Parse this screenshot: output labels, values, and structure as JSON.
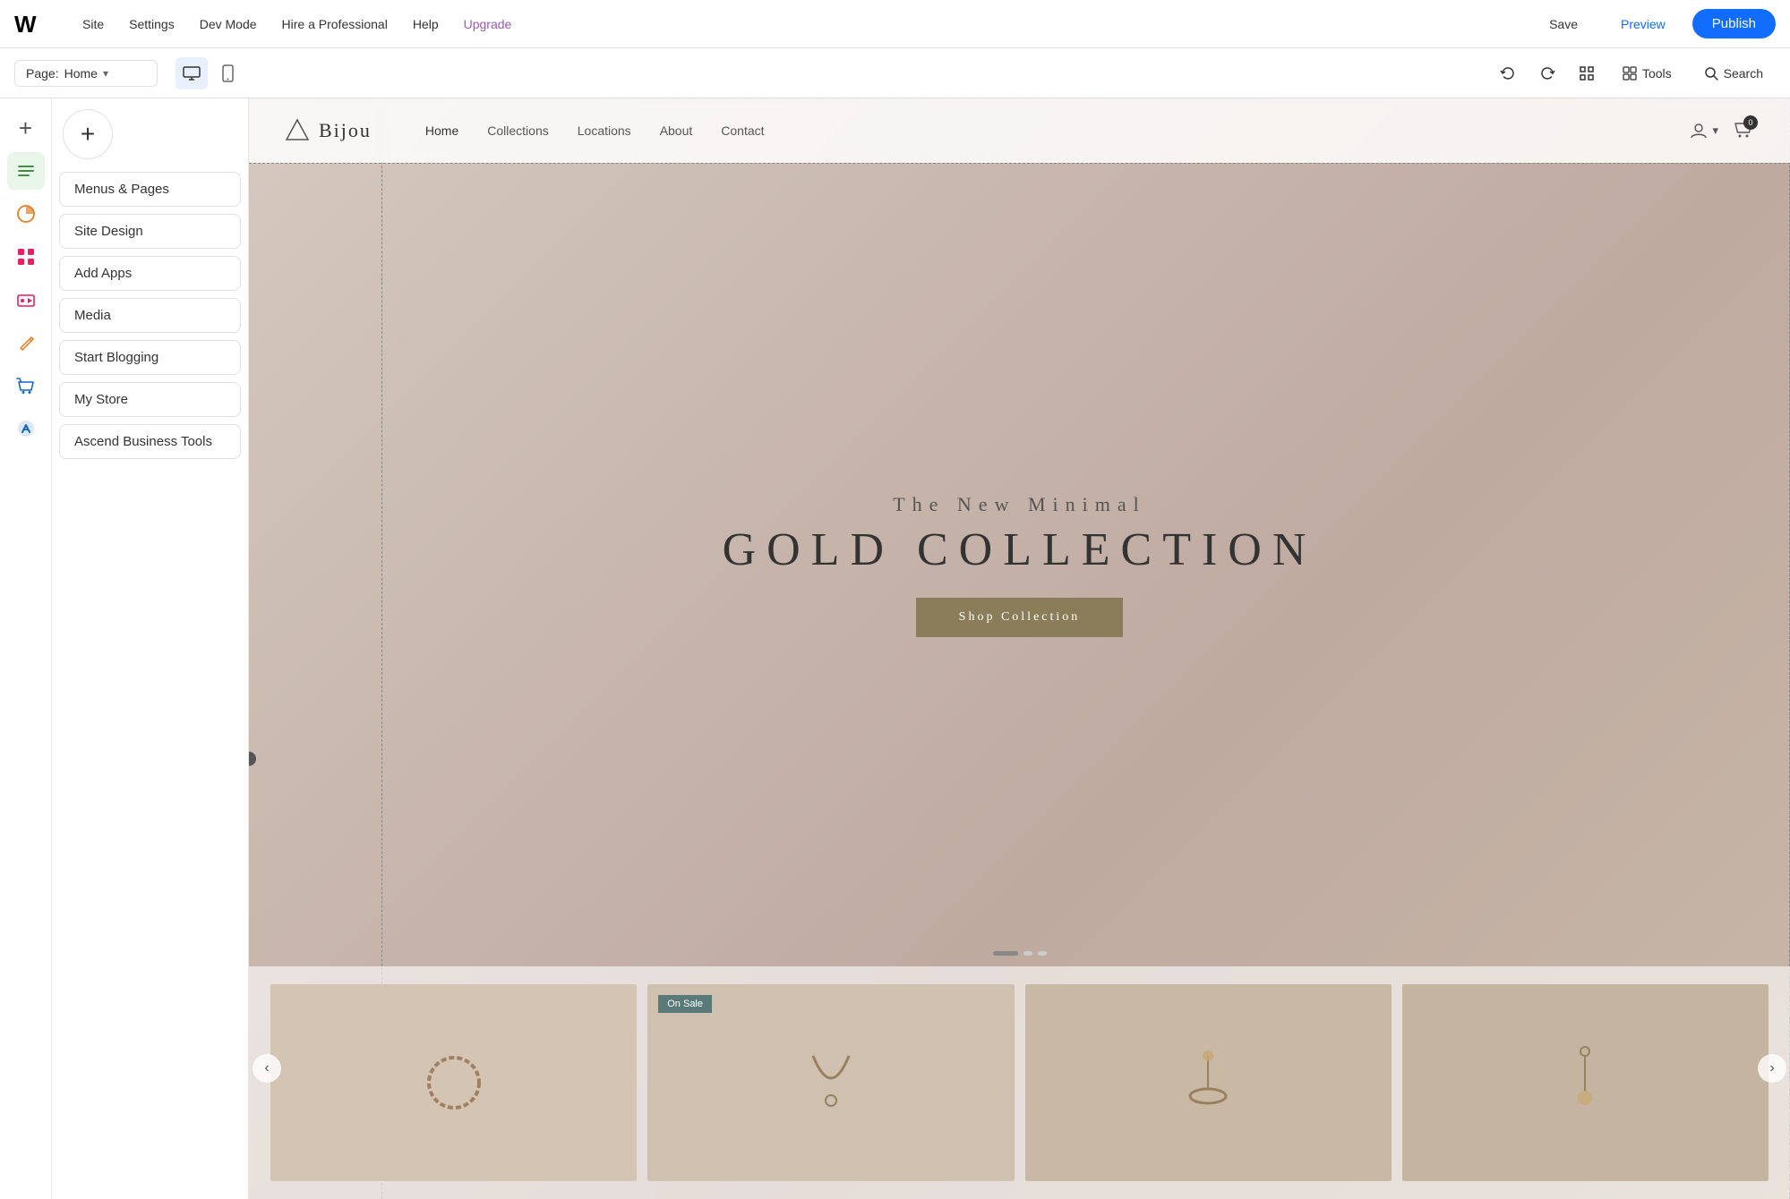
{
  "topbar": {
    "nav_items": [
      {
        "label": "Site",
        "id": "site"
      },
      {
        "label": "Settings",
        "id": "settings"
      },
      {
        "label": "Dev Mode",
        "id": "dev-mode"
      },
      {
        "label": "Hire a Professional",
        "id": "hire"
      },
      {
        "label": "Help",
        "id": "help"
      },
      {
        "label": "Upgrade",
        "id": "upgrade",
        "special": "upgrade"
      }
    ],
    "save_label": "Save",
    "preview_label": "Preview",
    "publish_label": "Publish"
  },
  "secondbar": {
    "page_label": "Page:",
    "page_name": "Home",
    "tools_label": "Tools",
    "search_label": "Search"
  },
  "left_panel": {
    "add_label": "+",
    "menu_items": [
      {
        "label": "Menus & Pages",
        "id": "menus-pages"
      },
      {
        "label": "Site Design",
        "id": "site-design"
      },
      {
        "label": "Add Apps",
        "id": "add-apps"
      },
      {
        "label": "Media",
        "id": "media"
      },
      {
        "label": "Start Blogging",
        "id": "start-blogging"
      },
      {
        "label": "My Store",
        "id": "my-store"
      },
      {
        "label": "Ascend Business Tools",
        "id": "ascend"
      }
    ]
  },
  "sidebar_icons": [
    {
      "id": "add",
      "icon": "+",
      "style": "plain"
    },
    {
      "id": "pages",
      "icon": "≡",
      "style": "active-green"
    },
    {
      "id": "design",
      "icon": "◐",
      "style": "active-orange"
    },
    {
      "id": "apps",
      "icon": "⊞",
      "style": "active-pink"
    },
    {
      "id": "media",
      "icon": "▦",
      "style": "plain"
    },
    {
      "id": "blog",
      "icon": "✎",
      "style": "active-orange"
    },
    {
      "id": "store",
      "icon": "🛍",
      "style": "active-blue"
    },
    {
      "id": "ascend",
      "icon": "↑",
      "style": "active-ascend"
    }
  ],
  "preview": {
    "navbar": {
      "logo_text": "Bijou",
      "nav_items": [
        "Home",
        "Collections",
        "Locations",
        "About",
        "Contact"
      ]
    },
    "hero": {
      "subtitle": "The New Minimal",
      "title": "GOLD COLLECTION",
      "cta": "Shop Collection"
    },
    "on_sale_badge": "On Sale",
    "prev_arrow": "‹",
    "next_arrow": "›"
  }
}
